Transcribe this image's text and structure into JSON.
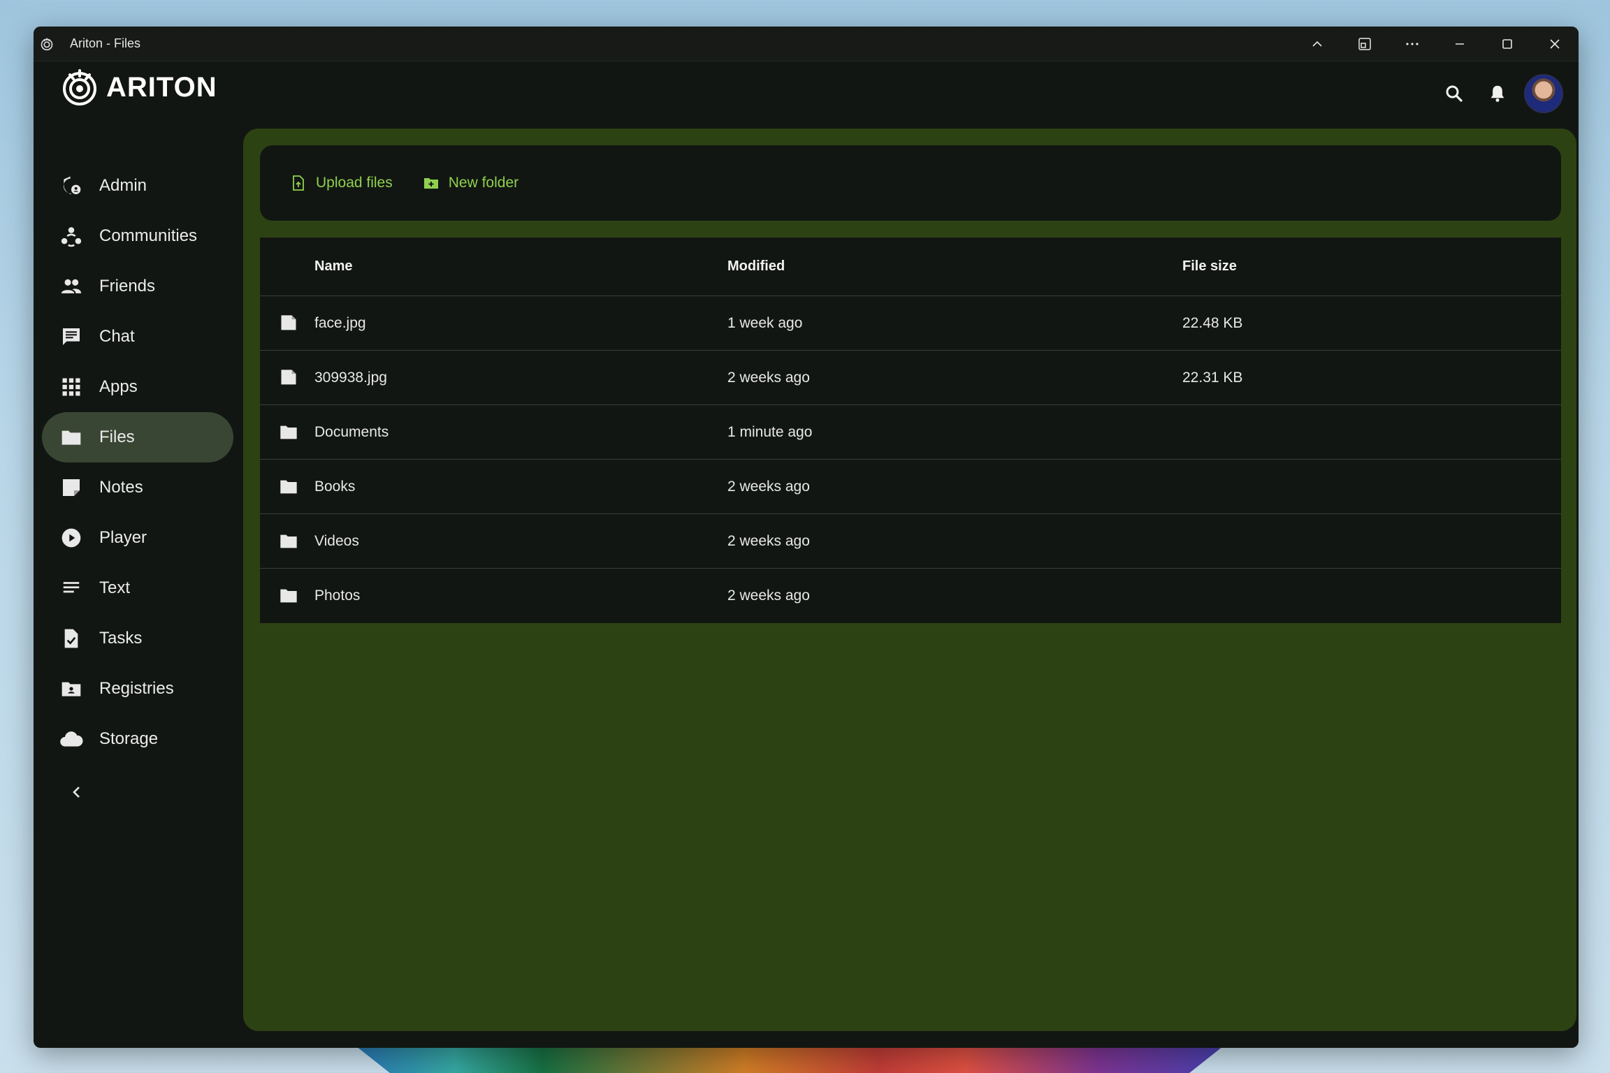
{
  "window": {
    "title": "Ariton - Files"
  },
  "brand": {
    "name": "ARITON"
  },
  "sidebar": {
    "items": [
      {
        "label": "Admin",
        "icon": "admin-shield-icon"
      },
      {
        "label": "Communities",
        "icon": "communities-icon"
      },
      {
        "label": "Friends",
        "icon": "people-icon"
      },
      {
        "label": "Chat",
        "icon": "chat-icon"
      },
      {
        "label": "Apps",
        "icon": "apps-grid-icon"
      },
      {
        "label": "Files",
        "icon": "folder-icon",
        "active": true
      },
      {
        "label": "Notes",
        "icon": "note-icon"
      },
      {
        "label": "Player",
        "icon": "play-icon"
      },
      {
        "label": "Text",
        "icon": "text-lines-icon"
      },
      {
        "label": "Tasks",
        "icon": "task-check-icon"
      },
      {
        "label": "Registries",
        "icon": "registry-folder-icon"
      },
      {
        "label": "Storage",
        "icon": "cloud-icon"
      }
    ],
    "collapse_icon": "chevron-left-icon"
  },
  "toolbar": {
    "upload_label": "Upload files",
    "new_folder_label": "New folder"
  },
  "table": {
    "columns": [
      "Name",
      "Modified",
      "File size"
    ],
    "rows": [
      {
        "name": "face.jpg",
        "modified": "1 week ago",
        "size": "22.48 KB",
        "type": "file"
      },
      {
        "name": "309938.jpg",
        "modified": "2 weeks ago",
        "size": "22.31 KB",
        "type": "file"
      },
      {
        "name": "Documents",
        "modified": "1 minute ago",
        "size": "",
        "type": "folder"
      },
      {
        "name": "Books",
        "modified": "2 weeks ago",
        "size": "",
        "type": "folder"
      },
      {
        "name": "Videos",
        "modified": "2 weeks ago",
        "size": "",
        "type": "folder"
      },
      {
        "name": "Photos",
        "modified": "2 weeks ago",
        "size": "",
        "type": "folder"
      }
    ]
  },
  "colors": {
    "accent": "#8fd14f",
    "panel_bg": "#2d4212",
    "window_bg": "#121612",
    "active_nav": "#3a4634"
  }
}
